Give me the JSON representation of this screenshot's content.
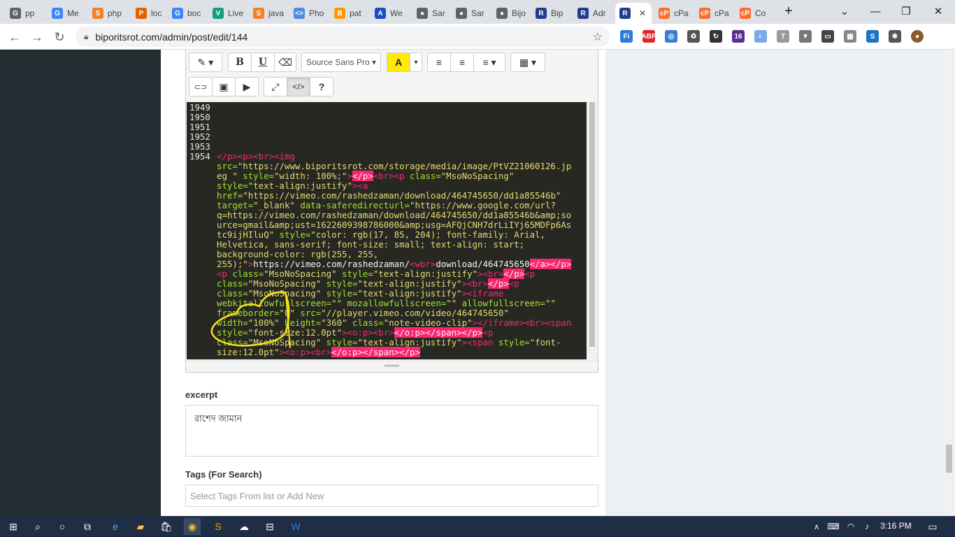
{
  "tabs": [
    {
      "title": "pp",
      "fav": "G",
      "color": "#5f6368"
    },
    {
      "title": "Me",
      "fav": "G",
      "color": "#4285f4"
    },
    {
      "title": "php",
      "fav": "S",
      "color": "#f48024"
    },
    {
      "title": "loc",
      "fav": "P",
      "color": "#e66000"
    },
    {
      "title": "boc",
      "fav": "G",
      "color": "#4285f4"
    },
    {
      "title": "Live",
      "fav": "V",
      "color": "#12a07e"
    },
    {
      "title": "java",
      "fav": "S",
      "color": "#f48024"
    },
    {
      "title": "Pho",
      "fav": "<>",
      "color": "#4d8be8"
    },
    {
      "title": "pat",
      "fav": "B",
      "color": "#ff9800"
    },
    {
      "title": "We",
      "fav": "A",
      "color": "#1a4fc4"
    },
    {
      "title": "Sar",
      "fav": "●",
      "color": "#5f6368"
    },
    {
      "title": "Sar",
      "fav": "●",
      "color": "#5f6368"
    },
    {
      "title": "Bijo",
      "fav": "●",
      "color": "#5f6368"
    },
    {
      "title": "Bip",
      "fav": "R",
      "color": "#243c8e"
    },
    {
      "title": "Adr",
      "fav": "R",
      "color": "#243c8e"
    },
    {
      "title": "",
      "fav": "R",
      "color": "#243c8e"
    },
    {
      "title": "cPa",
      "fav": "cP",
      "color": "#ff6c2c"
    },
    {
      "title": "cPa",
      "fav": "cP",
      "color": "#ff6c2c"
    },
    {
      "title": "Co",
      "fav": "cP",
      "color": "#ff6c2c"
    }
  ],
  "window": {
    "new_tab": "+",
    "menu": "⌄",
    "minimize": "—",
    "maximize": "❐",
    "close": "✕",
    "tab_close": "✕"
  },
  "address": {
    "url": "biporitsrot.com/admin/post/edit/144"
  },
  "extensions": [
    {
      "label": "Fi",
      "color": "#2b7bd8"
    },
    {
      "label": "ABP",
      "color": "#e3242b"
    },
    {
      "label": "◎",
      "color": "#3c7bd6"
    },
    {
      "label": "♻",
      "color": "#555"
    },
    {
      "label": "↻",
      "color": "#333"
    },
    {
      "label": "16",
      "color": "#5a2d91"
    },
    {
      "label": "◐",
      "color": "#7aa9e6"
    },
    {
      "label": "T",
      "color": "#999"
    },
    {
      "label": "▼",
      "color": "#777"
    },
    {
      "label": "▭",
      "color": "#444"
    },
    {
      "label": "▦",
      "color": "#888"
    },
    {
      "label": "S",
      "color": "#1e74c4"
    },
    {
      "label": "✱",
      "color": "#555"
    },
    {
      "label": "●",
      "color": "#8a5a2b"
    }
  ],
  "toolbar": {
    "font_name": "Source Sans Pro ▾",
    "bold": "B",
    "underline": "U",
    "help": "?",
    "codeview": "</>",
    "magic": "✎",
    "eraser": "⌫",
    "ul": "≡",
    "ol": "≡",
    "align": "≡ ▾",
    "table": "▦ ▾",
    "link": "⊂⊃",
    "picture": "▣",
    "video": "▶",
    "fullscreen": "⤢",
    "color_a": "A",
    "color_caret": "▾"
  },
  "code": {
    "gutter": "1949\n1950\n1951\n1952\n1953\n1954"
  },
  "fields": {
    "excerpt_label": "excerpt",
    "excerpt_value": "রাশেদ জামান",
    "tags_label": "Tags (For Search)",
    "tags_placeholder": "Select Tags From list or Add New"
  },
  "taskbar": {
    "time": "3:16 PM"
  }
}
